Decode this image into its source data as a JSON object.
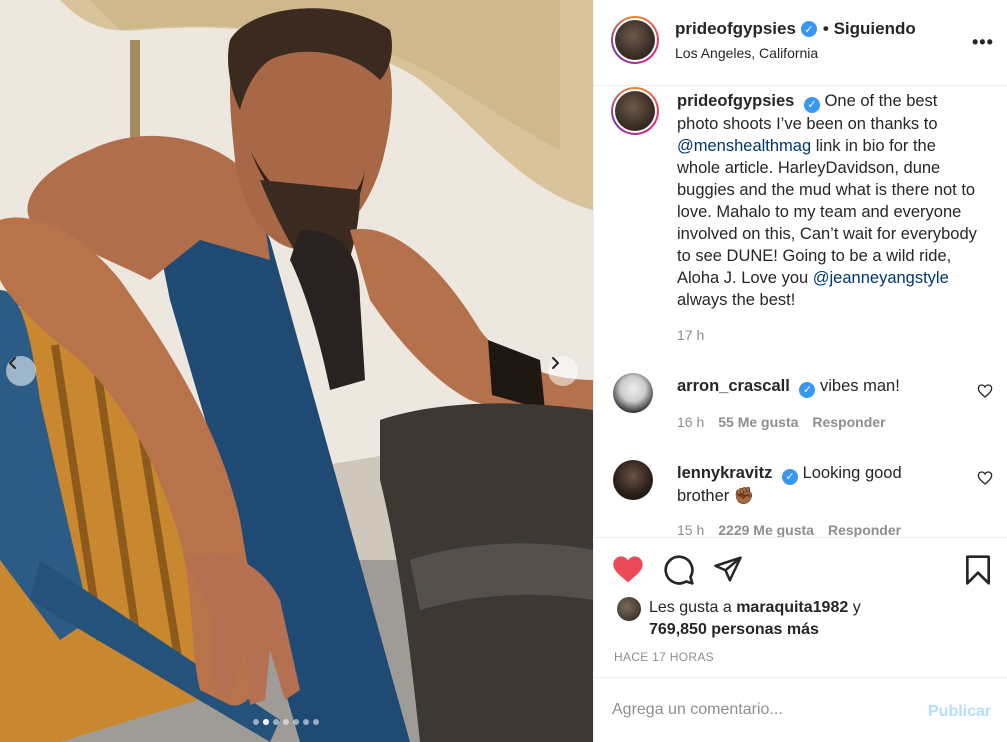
{
  "post": {
    "username": "prideofgypsies",
    "verified_mark": "✓",
    "follow_status": "• Siguiendo",
    "location": "Los Angeles, California",
    "more_icon": "more-horizontal-icon"
  },
  "caption": {
    "username": "prideofgypsies",
    "text_1": "One of the best photo shoots I’ve been on thanks to",
    "mention_1": "@menshealthmag",
    "text_2": "link in bio for the whole article. HarleyDavidson, dune buggies and the mud what is there not to love. Mahalo to my team and everyone involved on this, Can’t wait for everybody to see DUNE! Going to be a wild ride, Aloha J. Love you",
    "mention_2": "@jeanneyangstyle",
    "text_3": "always the best!",
    "time": "17 h"
  },
  "comments": [
    {
      "username": "arron_crascall",
      "text": "vibes man!",
      "time": "16 h",
      "likes": "55 Me gusta",
      "reply": "Responder"
    },
    {
      "username": "lennykravitz",
      "text": "Looking good brother",
      "emoji": "✊🏾",
      "time": "15 h",
      "likes": "2229 Me gusta",
      "reply": "Responder"
    }
  ],
  "likes": {
    "prefix": "Les gusta a",
    "user": "maraquita1982",
    "connector": "y",
    "others": "769,850 personas más"
  },
  "timestamp": "HACE 17 HORAS",
  "comment_box": {
    "placeholder": "Agrega un comentario...",
    "publish_label": "Publicar"
  },
  "carousel": {
    "total": 7,
    "active_index": 1
  },
  "colors": {
    "like_red": "#ed4956",
    "verified_blue": "#3897f0",
    "mention": "#00376b",
    "muted": "#8e8e8e",
    "publish_disabled": "#b2dffc"
  }
}
